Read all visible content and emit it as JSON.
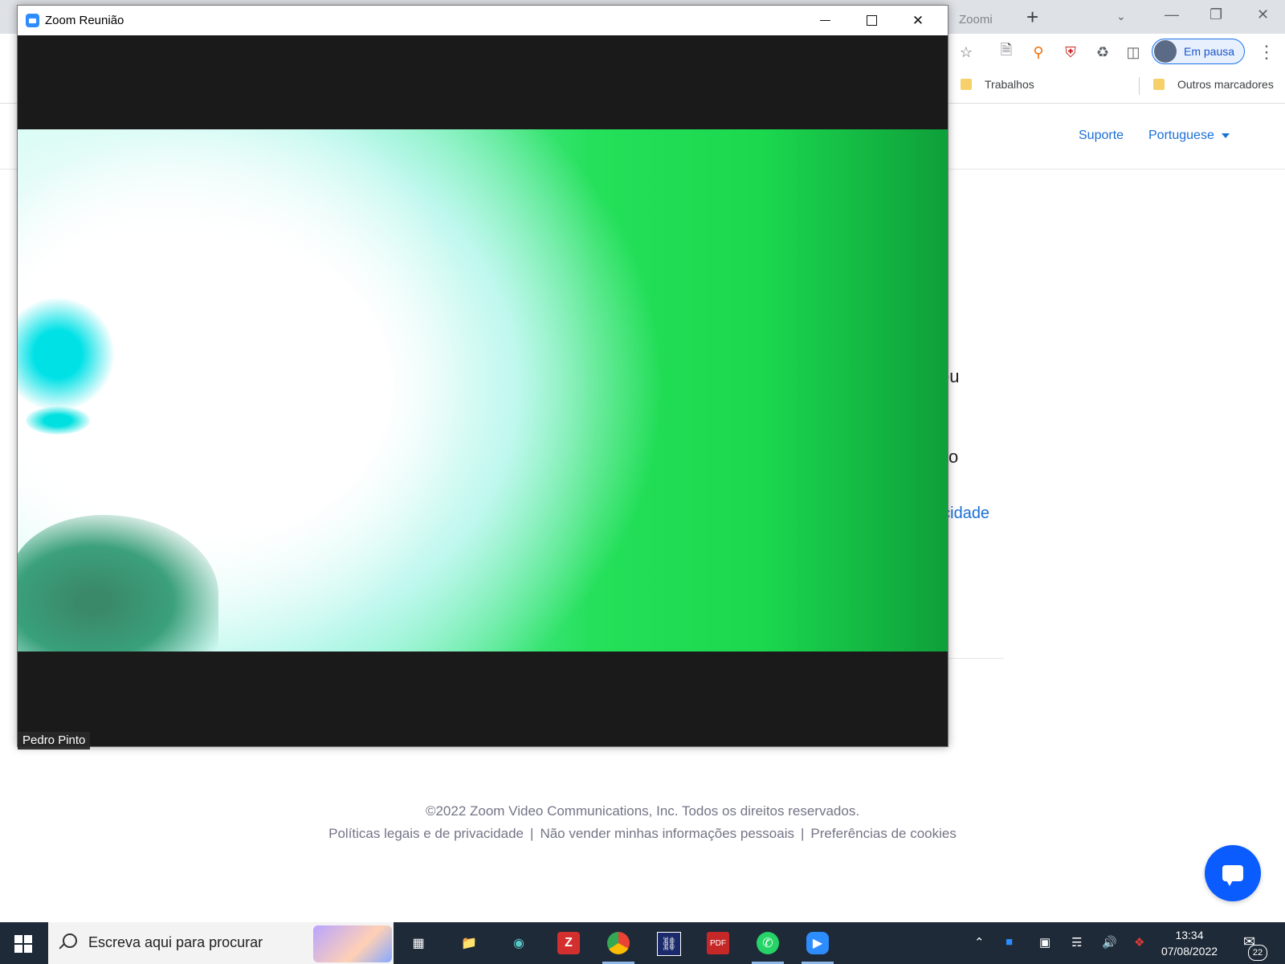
{
  "browser": {
    "tab": {
      "favicon": "S",
      "label": "Zoomi"
    },
    "new_tab": "+",
    "profile": {
      "label": "Em pausa"
    },
    "bookmarks": [
      {
        "label": "Trabalhos"
      },
      {
        "label": "Outros marcadores"
      }
    ],
    "page_nav": {
      "support": "Suporte",
      "language": "Portuguese"
    },
    "peek_text": {
      "line1": "eu",
      "line2": "xo",
      "link": "acidade"
    },
    "footer": {
      "copyright": "©2022 Zoom Video Communications, Inc. Todos os direitos reservados.",
      "links": [
        "Políticas legais e de privacidade",
        "Não vender minhas informações pessoais",
        "Preferências de cookies"
      ]
    }
  },
  "zoom_window": {
    "title": "Zoom Reunião",
    "participant_name": "Pedro Pinto"
  },
  "taskbar": {
    "search_placeholder": "Escreva aqui para procurar",
    "time": "13:34",
    "date": "07/08/2022",
    "notification_count": "22",
    "apps": [
      "task-view-icon",
      "file-explorer-icon",
      "eye-app-icon",
      "zotero-icon",
      "chrome-icon",
      "app-icon",
      "pdf-icon",
      "whatsapp-icon",
      "zoom-icon"
    ]
  },
  "colors": {
    "zoom_blue": "#2d8cff",
    "link_blue": "#1a6fd6",
    "taskbar_bg": "#1f2a38",
    "video_green": "#1bd84e"
  }
}
